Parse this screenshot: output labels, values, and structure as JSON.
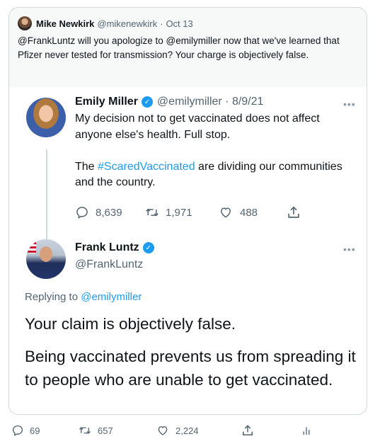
{
  "outer_tweet": {
    "author_name": "Mike Newkirk",
    "handle": "@mikenewkirk",
    "separator": "·",
    "date": "Oct 13",
    "text": "@FrankLuntz will you apologize to @emilymiller now that we've learned that Pfizer never tested for transmission? Your charge is objectively false."
  },
  "quoted_thread": {
    "parent": {
      "author_name": "Emily Miller",
      "handle_date": "@emilymiller · 8/9/21",
      "verified": true,
      "text_line1": "My decision not to get vaccinated does not affect anyone else's health. Full stop.",
      "text_line2_pre": "The ",
      "hashtag": "#ScaredVaccinated",
      "text_line2_post": " are dividing our communities and the country.",
      "replies": "8,639",
      "retweets": "1,971",
      "likes": "488"
    },
    "reply": {
      "author_name": "Frank Luntz",
      "handle": "@FrankLuntz",
      "verified": true,
      "replying_label": "Replying to ",
      "replying_mention": "@emilymiller",
      "paragraph1": "Your claim is objectively false.",
      "paragraph2": "Being vaccinated prevents us from spreading it to people who are unable to get vaccinated."
    }
  },
  "outer_actions": {
    "replies": "69",
    "retweets": "657",
    "likes": "2,224"
  },
  "colors": {
    "accent": "#1d9bf0",
    "muted": "#536471",
    "border": "#cfd9de"
  }
}
